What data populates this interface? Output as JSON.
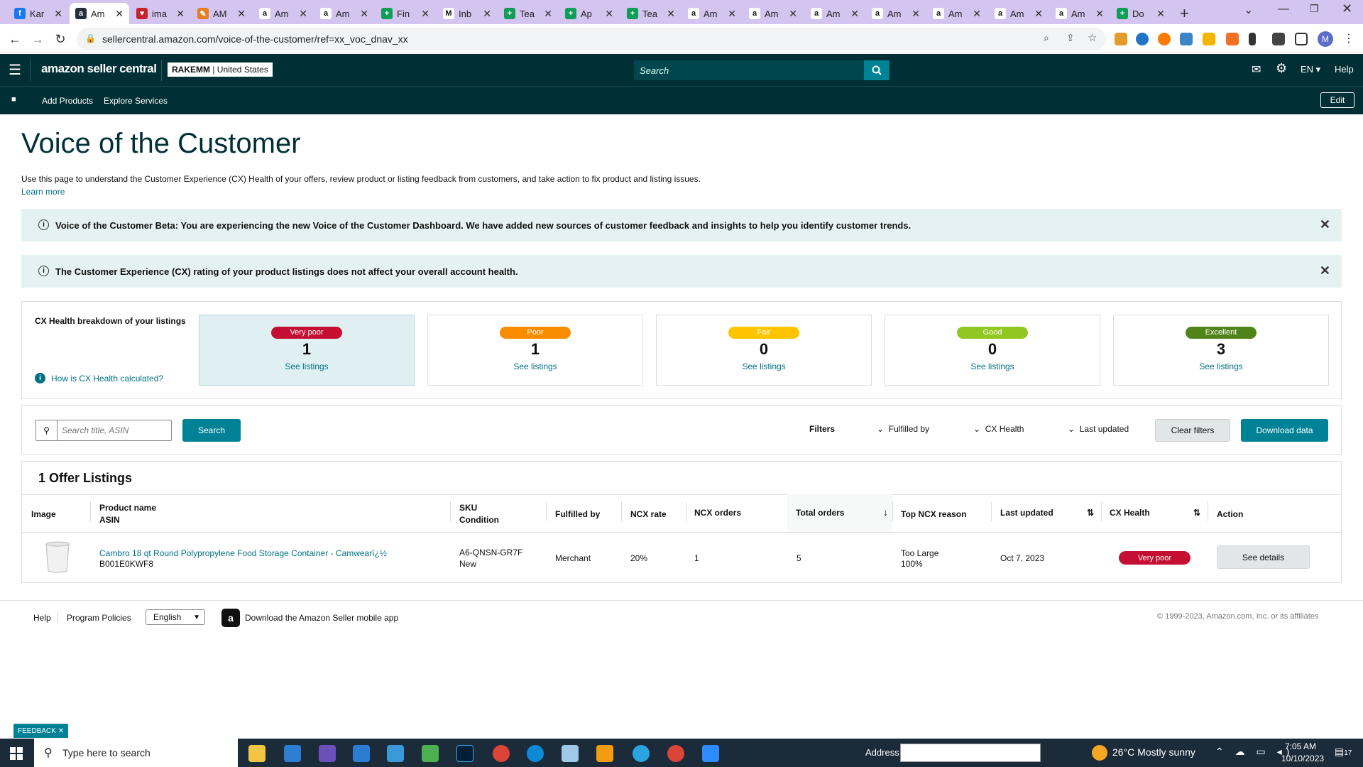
{
  "browser": {
    "tabs": [
      {
        "label": "Kar",
        "icon": "facebook-icon",
        "color": "#1877f2",
        "glyph": "f"
      },
      {
        "label": "Am",
        "icon": "amazon-icon",
        "color": "#232f3e",
        "glyph": "a",
        "active": true
      },
      {
        "label": "ima",
        "icon": "pinterest-icon",
        "color": "#c8232c",
        "glyph": "♥"
      },
      {
        "label": "AM",
        "icon": "app-icon",
        "color": "#e67e22",
        "glyph": "✎"
      },
      {
        "label": "Am",
        "icon": "amazon-icon",
        "color": "#ffffff",
        "glyph": "a"
      },
      {
        "label": "Am",
        "icon": "amazon-icon",
        "color": "#ffffff",
        "glyph": "a"
      },
      {
        "label": "Fin",
        "icon": "sheets-icon",
        "color": "#0f9d58",
        "glyph": "+"
      },
      {
        "label": "Inb",
        "icon": "gmail-icon",
        "color": "#ffffff",
        "glyph": "M"
      },
      {
        "label": "Tea",
        "icon": "sheets-icon",
        "color": "#0f9d58",
        "glyph": "+"
      },
      {
        "label": "Ap",
        "icon": "sheets-icon",
        "color": "#0f9d58",
        "glyph": "+"
      },
      {
        "label": "Tea",
        "icon": "sheets-icon",
        "color": "#0f9d58",
        "glyph": "+"
      },
      {
        "label": "Am",
        "icon": "amazon-icon",
        "color": "#ffffff",
        "glyph": "a"
      },
      {
        "label": "Am",
        "icon": "amazon-icon",
        "color": "#ffffff",
        "glyph": "a"
      },
      {
        "label": "Am",
        "icon": "amazon-icon",
        "color": "#ffffff",
        "glyph": "a"
      },
      {
        "label": "Am",
        "icon": "amazon-icon",
        "color": "#ffffff",
        "glyph": "a"
      },
      {
        "label": "Am",
        "icon": "amazon-icon",
        "color": "#ffffff",
        "glyph": "a"
      },
      {
        "label": "Am",
        "icon": "amazon-icon",
        "color": "#ffffff",
        "glyph": "a"
      },
      {
        "label": "Am",
        "icon": "amazon-icon",
        "color": "#ffffff",
        "glyph": "a"
      },
      {
        "label": "Do",
        "icon": "sheets-icon",
        "color": "#0f9d58",
        "glyph": "+"
      }
    ],
    "url": "sellercentral.amazon.com/voice-of-the-customer/ref=xx_voc_dnav_xx",
    "profile_initial": "M"
  },
  "header": {
    "logo": "amazon seller central",
    "account": "RAKEMM",
    "marketplace": "United States",
    "search_placeholder": "Search",
    "language": "EN",
    "help": "Help",
    "nav": [
      "Add Products",
      "Explore Services"
    ],
    "edit": "Edit"
  },
  "page": {
    "title": "Voice of the Customer",
    "description": "Use this page to understand the Customer Experience (CX) Health of your offers, review product or listing feedback from customers, and take action to fix product and listing issues.",
    "learn_more": "Learn more",
    "alert1": "Voice of the Customer Beta: You are experiencing the new Voice of the Customer Dashboard. We have added new sources of customer feedback and insights to help you identify customer trends.",
    "alert2": "The Customer Experience (CX) rating of your product listings does not affect your overall account health."
  },
  "cx": {
    "title": "CX Health breakdown of your listings",
    "how_link": "How is CX Health calculated?",
    "cards": [
      {
        "label": "Very poor",
        "count": "1",
        "link": "See listings",
        "color": "#c40e32",
        "selected": true
      },
      {
        "label": "Poor",
        "count": "1",
        "link": "See listings",
        "color": "#fa8c00"
      },
      {
        "label": "Fair",
        "count": "0",
        "link": "See listings",
        "color": "#ffc400"
      },
      {
        "label": "Good",
        "count": "0",
        "link": "See listings",
        "color": "#90c720"
      },
      {
        "label": "Excellent",
        "count": "3",
        "link": "See listings",
        "color": "#508418"
      }
    ]
  },
  "filters": {
    "search_placeholder": "Search title, ASIN",
    "search_btn": "Search",
    "filters_label": "Filters",
    "fulfilled_by": "Fulfilled by",
    "cx_health": "CX Health",
    "last_updated": "Last updated",
    "clear": "Clear filters",
    "download": "Download data"
  },
  "table": {
    "title": "1 Offer Listings",
    "headers": {
      "image": "Image",
      "product": "Product name",
      "asin": "ASIN",
      "sku": "SKU",
      "condition": "Condition",
      "fulfilled": "Fulfilled by",
      "ncx_rate": "NCX rate",
      "ncx_orders": "NCX orders",
      "total_orders": "Total orders",
      "top_reason": "Top NCX reason",
      "last_updated": "Last updated",
      "cx_health": "CX Health",
      "action": "Action"
    },
    "row": {
      "product_name": "Cambro 18 qt Round Polypropylene Food Storage Container - Camwearï¿½",
      "asin": "B001E0KWF8",
      "sku": "A6-QNSN-GR7F",
      "condition": "New",
      "fulfilled": "Merchant",
      "ncx_rate": "20%",
      "ncx_orders": "1",
      "total_orders": "5",
      "top_reason": "Too Large",
      "top_reason_pct": "100%",
      "last_updated": "Oct 7, 2023",
      "cx_health": "Very poor",
      "action": "See details"
    }
  },
  "footer": {
    "help": "Help",
    "policies": "Program Policies",
    "language": "English",
    "app": "Download the Amazon Seller mobile app",
    "copyright": "© 1999-2023, Amazon.com, Inc. or its affiliates",
    "feedback": "FEEDBACK"
  },
  "taskbar": {
    "search": "Type here to search",
    "address_label": "Address",
    "weather": "26°C  Mostly sunny",
    "time": "7:05 AM",
    "date": "10/10/2023",
    "notif_count": "17"
  }
}
